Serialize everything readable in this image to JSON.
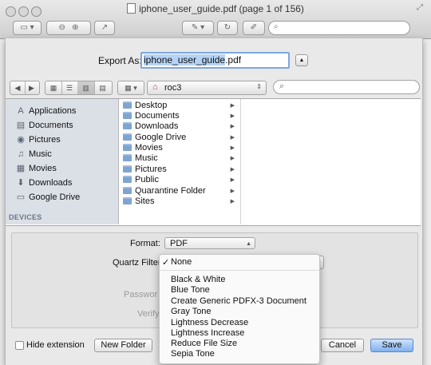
{
  "window": {
    "title": "iphone_user_guide.pdf (page 1 of 156)"
  },
  "toolbar": {
    "sidebar_icon": "sidebar-toggle-icon",
    "zoom_out_icon": "zoom-out-icon",
    "zoom_in_icon": "zoom-in-icon",
    "share_icon": "share-icon",
    "annotate_icon": "pen-icon",
    "rotate_icon": "rotate-icon",
    "edit_icon": "edit-icon",
    "search_icon": "search-icon"
  },
  "export": {
    "label": "Export As:",
    "filename_selected": "iphone_user_guide",
    "filename_ext": ".pdf"
  },
  "path": {
    "folder": "roc3"
  },
  "sidebar": {
    "favorites": [
      {
        "label": "Applications",
        "icon": "applications-icon"
      },
      {
        "label": "Documents",
        "icon": "documents-icon"
      },
      {
        "label": "Pictures",
        "icon": "camera-icon"
      },
      {
        "label": "Music",
        "icon": "music-note-icon"
      },
      {
        "label": "Movies",
        "icon": "film-icon"
      },
      {
        "label": "Downloads",
        "icon": "download-icon"
      },
      {
        "label": "Google Drive",
        "icon": "folder-icon"
      }
    ],
    "devices_heading": "DEVICES"
  },
  "folders": [
    "Desktop",
    "Documents",
    "Downloads",
    "Google Drive",
    "Movies",
    "Music",
    "Pictures",
    "Public",
    "Quarantine Folder",
    "Sites"
  ],
  "format": {
    "label": "Format:",
    "value": "PDF"
  },
  "quartz": {
    "label": "Quartz Filter",
    "selected": "None",
    "check": "✓",
    "options": [
      "Black & White",
      "Blue Tone",
      "Create Generic PDFX-3 Document",
      "Gray Tone",
      "Lightness Decrease",
      "Lightness Increase",
      "Reduce File Size",
      "Sepia Tone"
    ]
  },
  "encrypt": {
    "password_label": "Passwor",
    "verify_label": "Verify"
  },
  "footer": {
    "hide_extension": "Hide extension",
    "new_folder": "New Folder",
    "cancel": "Cancel",
    "save": "Save"
  }
}
